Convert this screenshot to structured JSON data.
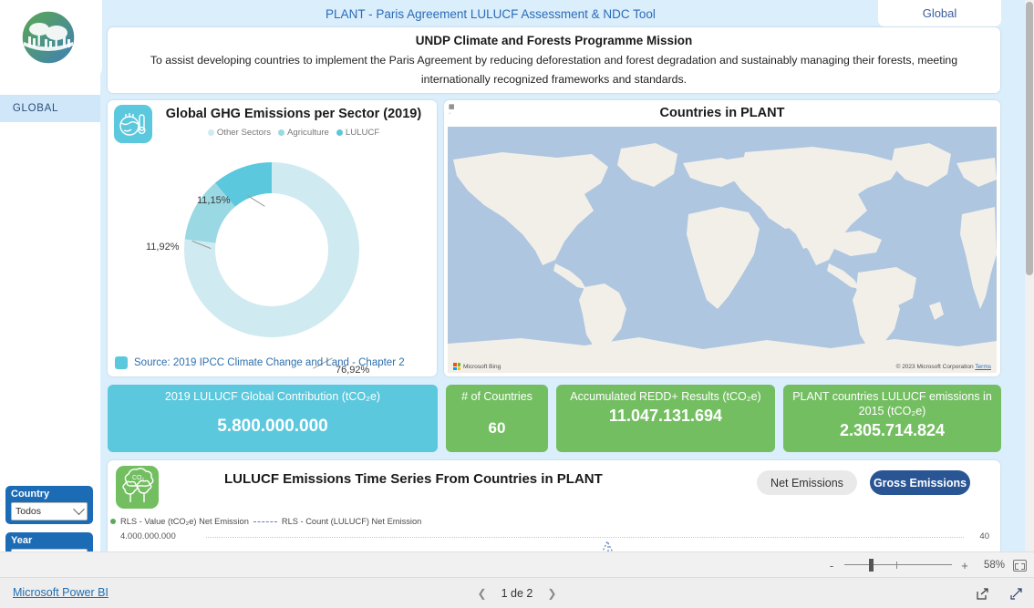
{
  "header": {
    "report_title": "PLANT - Paris Agreement LULUCF Assessment & NDC Tool",
    "active_tab": "Global"
  },
  "sidebar": {
    "logo_name": "plant-forest-logo",
    "nav_pill": "GLOBAL",
    "slicers": [
      {
        "title": "Country",
        "value": "Todos"
      },
      {
        "title": "Year",
        "value": ""
      }
    ]
  },
  "mission": {
    "title": "UNDP Climate and Forests Programme Mission",
    "body": "To assist developing countries to implement the Paris Agreement by reducing deforestation and forest degradation and sustainably managing their forests, meeting internationally recognized frameworks and standards."
  },
  "donut": {
    "title": "Global GHG Emissions per Sector (2019)",
    "source": "Source: 2019 IPCC Climate Change and Land - Chapter 2",
    "icon": "globe-thermometer-icon"
  },
  "map": {
    "title": "Countries in PLANT",
    "brand": "Microsoft Bing",
    "attribution": "© 2023 Microsoft Corporation",
    "terms": "Terms"
  },
  "kpis": [
    {
      "label": "2019 LULUCF Global Contribution (tCO₂e)",
      "value": "5.800.000.000",
      "color": "#5bc8dd"
    },
    {
      "label": "# of Countries",
      "value": "60",
      "color": "#74be62"
    },
    {
      "label": "Accumulated REDD+ Results (tCO₂e)",
      "value": "11.047.131.694",
      "color": "#74be62"
    },
    {
      "label": "PLANT countries LULUCF emissions in 2015 (tCO₂e)",
      "value": "2.305.714.824",
      "color": "#74be62"
    }
  ],
  "timeseries": {
    "title": "LULUCF Emissions Time Series From Countries in PLANT",
    "icon": "trees-co2-icon",
    "toggle": {
      "net_label": "Net Emissions",
      "gross_label": "Gross Emissions",
      "selected": "Gross Emissions"
    },
    "legend": [
      "RLS - Value (tCO₂e) Net Emission",
      "RLS - Count (LULUCF) Net Emission"
    ],
    "y_left_top": "4.000.000.000",
    "y_right_top": "40"
  },
  "statusbar": {
    "zoom_level": "58%",
    "zoom_out": "-",
    "zoom_in": "+",
    "fit_icon": "fit-to-page-icon"
  },
  "footer": {
    "brand_link": "Microsoft Power BI",
    "page_label": "1 de 2",
    "prev_icon": "chevron-left-icon",
    "next_icon": "chevron-right-icon",
    "share_icon": "share-icon",
    "fullscreen_icon": "fullscreen-icon"
  },
  "chart_data": {
    "type": "pie",
    "title": "Global GHG Emissions per Sector (2019)",
    "labels": [
      "Other Sectors",
      "Agriculture",
      "LULUCF"
    ],
    "values": [
      76.92,
      11.92,
      11.15
    ],
    "value_labels": [
      "76,92%",
      "11,92%",
      "11,15%"
    ],
    "colors": [
      "#cfeaf0",
      "#9ad8e4",
      "#5bc8dd"
    ],
    "legend_position": "top",
    "donut": true,
    "units": "%"
  }
}
